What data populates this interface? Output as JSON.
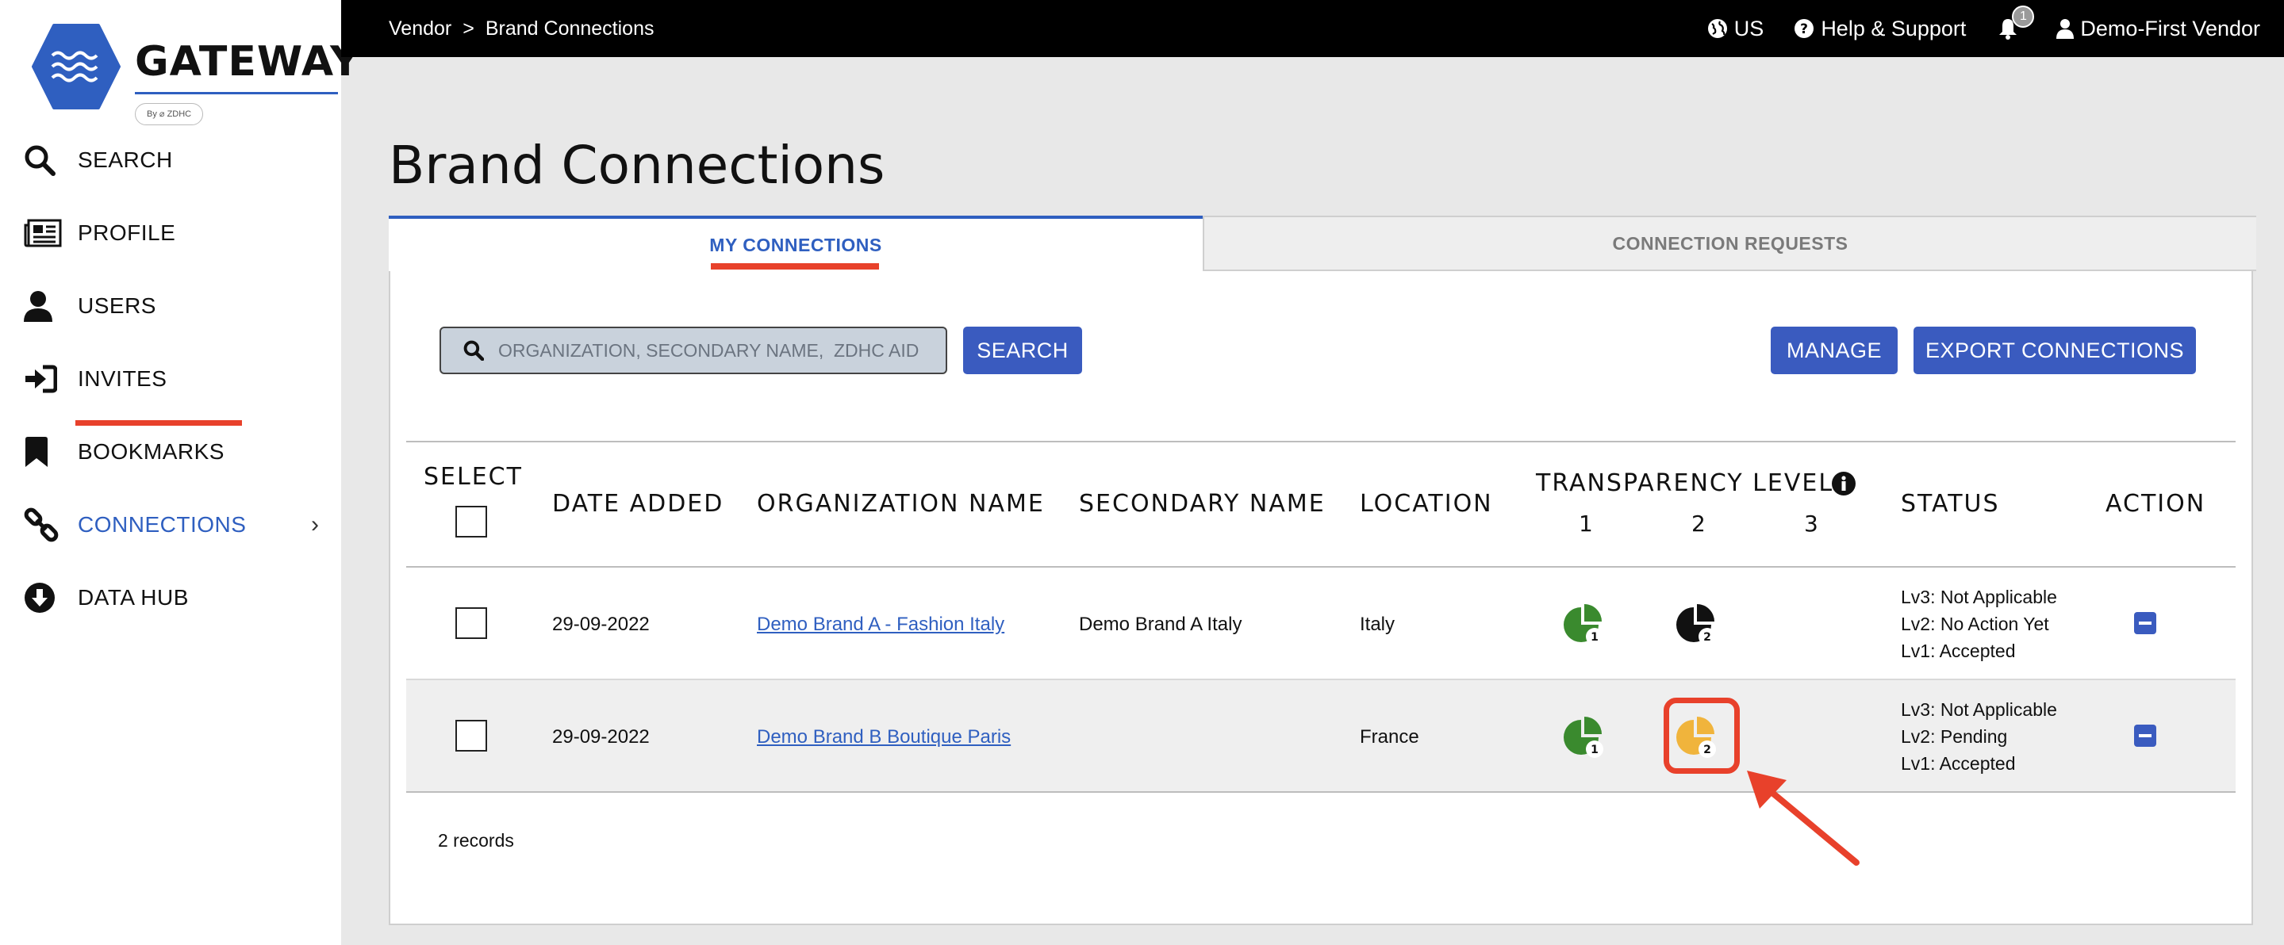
{
  "logo": {
    "name": "GATEWAY",
    "badge": "By ⌀ ZDHC"
  },
  "sidebar": {
    "items": [
      {
        "label": "SEARCH",
        "icon": "search-icon"
      },
      {
        "label": "PROFILE",
        "icon": "newspaper-icon"
      },
      {
        "label": "USERS",
        "icon": "user-icon"
      },
      {
        "label": "INVITES",
        "icon": "sign-in-icon"
      },
      {
        "label": "BOOKMARKS",
        "icon": "bookmark-icon"
      },
      {
        "label": "CONNECTIONS",
        "icon": "link-icon",
        "active": true
      },
      {
        "label": "DATA HUB",
        "icon": "download-circle-icon"
      }
    ],
    "chevron": "›"
  },
  "topbar": {
    "breadcrumb": [
      "Vendor",
      "Brand Connections"
    ],
    "separator": ">",
    "language": "US",
    "help": "Help & Support",
    "notification_count": "1",
    "user": "Demo-First Vendor"
  },
  "page": {
    "title": "Brand Connections"
  },
  "tabs": {
    "my_connections": "MY CONNECTIONS",
    "connection_requests": "CONNECTION REQUESTS"
  },
  "search": {
    "placeholder": "ORGANIZATION, SECONDARY NAME,  ZDHC AID",
    "button": "SEARCH"
  },
  "actions": {
    "manage": "MANAGE",
    "export": "EXPORT CONNECTIONS"
  },
  "table": {
    "headers": {
      "select": "SELECT",
      "date_added": "DATE ADDED",
      "organization": "ORGANIZATION NAME",
      "secondary": "SECONDARY NAME",
      "location": "LOCATION",
      "transparency": "TRANSPARENCY LEVEL",
      "levels": [
        "1",
        "2",
        "3"
      ],
      "status": "STATUS",
      "action": "ACTION"
    },
    "rows": [
      {
        "date": "29-09-2022",
        "organization": "Demo Brand A - Fashion Italy",
        "secondary": "Demo Brand A Italy",
        "location": "Italy",
        "lv1": {
          "label": "1",
          "color": "#3a8a2e"
        },
        "lv2": {
          "label": "2",
          "color": "#111111"
        },
        "status": [
          "Lv3: Not Applicable",
          "Lv2: No Action Yet",
          "Lv1: Accepted"
        ]
      },
      {
        "date": "29-09-2022",
        "organization": "Demo Brand B Boutique Paris",
        "secondary": "",
        "location": "France",
        "lv1": {
          "label": "1",
          "color": "#3a8a2e"
        },
        "lv2": {
          "label": "2",
          "color": "#f0b43c"
        },
        "status": [
          "Lv3: Not Applicable",
          "Lv2: Pending",
          "Lv1: Accepted"
        ]
      }
    ],
    "records": "2 records"
  },
  "colors": {
    "accent": "#3a5bbf",
    "highlight": "#e8412b",
    "level_accepted": "#3a8a2e",
    "level_pending": "#f0b43c",
    "level_no_action": "#111111"
  }
}
